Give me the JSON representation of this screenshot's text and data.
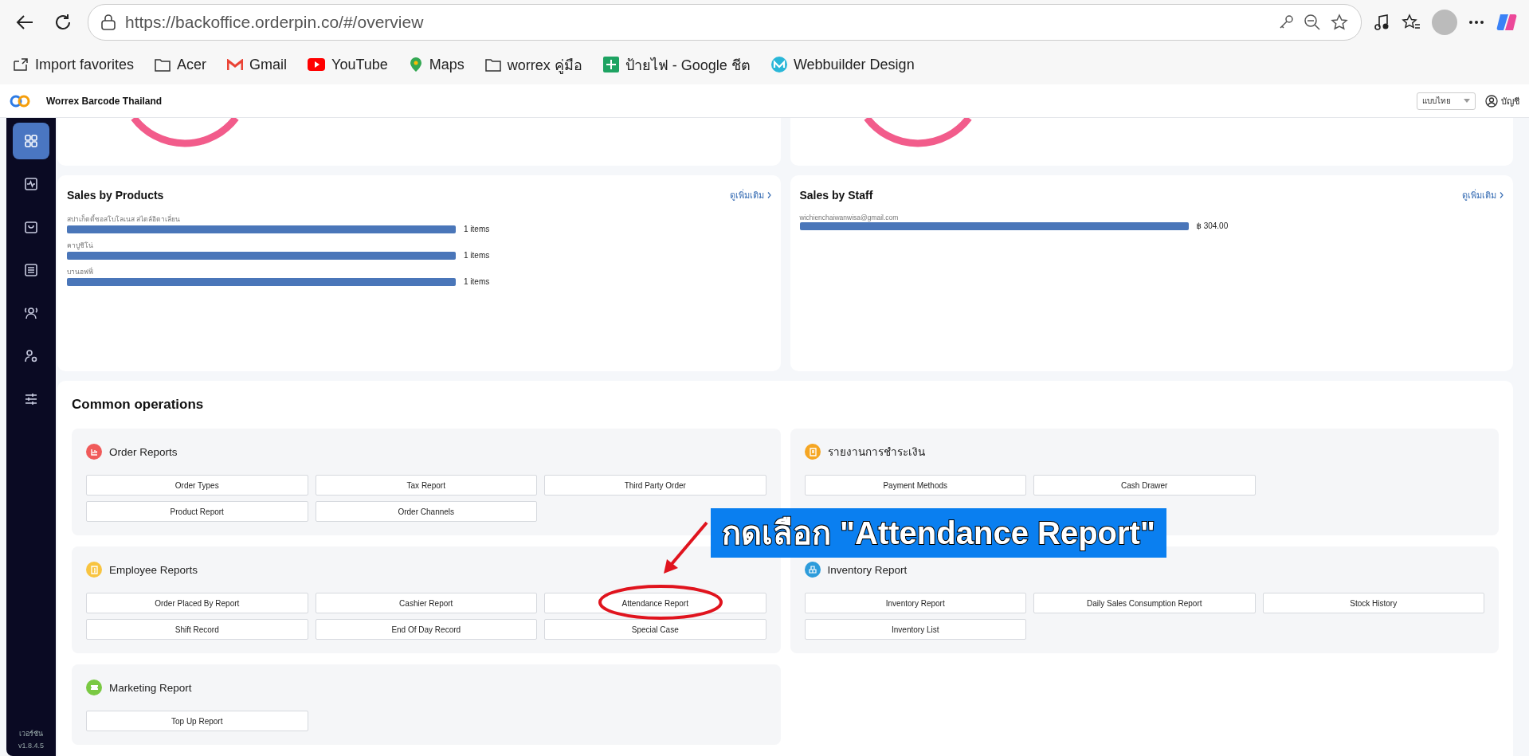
{
  "browser": {
    "url": "https://backoffice.orderpin.co/#/overview",
    "bookmarks": [
      {
        "label": "Import favorites",
        "kind": "import"
      },
      {
        "label": "Acer",
        "kind": "folder"
      },
      {
        "label": "Gmail",
        "kind": "gmail"
      },
      {
        "label": "YouTube",
        "kind": "youtube"
      },
      {
        "label": "Maps",
        "kind": "maps"
      },
      {
        "label": "worrex คู่มือ",
        "kind": "folder"
      },
      {
        "label": "ป้ายไฟ - Google ชีต",
        "kind": "sheets"
      },
      {
        "label": "Webbuilder Design",
        "kind": "web"
      }
    ]
  },
  "header": {
    "store": "Worrex Barcode Thailand",
    "language": "แบบไทย",
    "account": "บัญชี"
  },
  "sidebar": {
    "items": [
      {
        "kind": "grid",
        "selected": true
      },
      {
        "kind": "activity",
        "selected": false
      },
      {
        "kind": "bag",
        "selected": false
      },
      {
        "kind": "register",
        "selected": false
      },
      {
        "kind": "people",
        "selected": false
      },
      {
        "kind": "user-settings",
        "selected": false
      },
      {
        "kind": "sliders",
        "selected": false
      }
    ],
    "version_label": "เวอร์ชัน",
    "version": "v1.8.4.5"
  },
  "sales_cards": [
    {
      "title": "Sales by Products",
      "more": "ดูเพิ่มเติม",
      "rows": [
        {
          "name": "สปาเก็ตตี้ซอสโบโลเนส สไตล์อิตาเลี่ยน",
          "level": 1,
          "value": "1 items"
        },
        {
          "name": "คาปูชิโน่",
          "level": 1,
          "value": "1 items"
        },
        {
          "name": "บานอฟฟี่",
          "level": 1,
          "value": "1 items"
        }
      ]
    },
    {
      "title": "Sales by Staff",
      "more": "ดูเพิ่มเติม",
      "rows": [
        {
          "name": "wichienchaiwanwisa@gmail.com",
          "level": 1,
          "value": "฿ 304.00"
        }
      ]
    }
  ],
  "common_operations": {
    "title": "Common operations",
    "groups": [
      {
        "title": "Order Reports",
        "color": "#f05a5a",
        "kind": "chart",
        "items": [
          "Order Types",
          "Tax Report",
          "Third Party Order",
          "Product Report",
          "Order Channels"
        ]
      },
      {
        "title": "รายงานการชำระเงิน",
        "color": "#f5a623",
        "kind": "receipt",
        "items": [
          "Payment Methods",
          "Cash Drawer"
        ]
      },
      {
        "title": "Employee Reports",
        "color": "#f8c440",
        "kind": "badge",
        "items": [
          "Order Placed By Report",
          "Cashier Report",
          "Attendance Report",
          "Shift Record",
          "End Of Day Record",
          "Special Case"
        ]
      },
      {
        "title": "Inventory Report",
        "color": "#2d9cdb",
        "kind": "boxes",
        "items": [
          "Inventory Report",
          "Daily Sales Consumption Report",
          "Stock History",
          "Inventory List"
        ]
      },
      {
        "title": "Marketing Report",
        "color": "#7ac943",
        "kind": "ticket",
        "items": [
          "Top Up Report"
        ]
      }
    ]
  },
  "annotation": {
    "text": "กดเลือก \"Attendance Report\""
  }
}
